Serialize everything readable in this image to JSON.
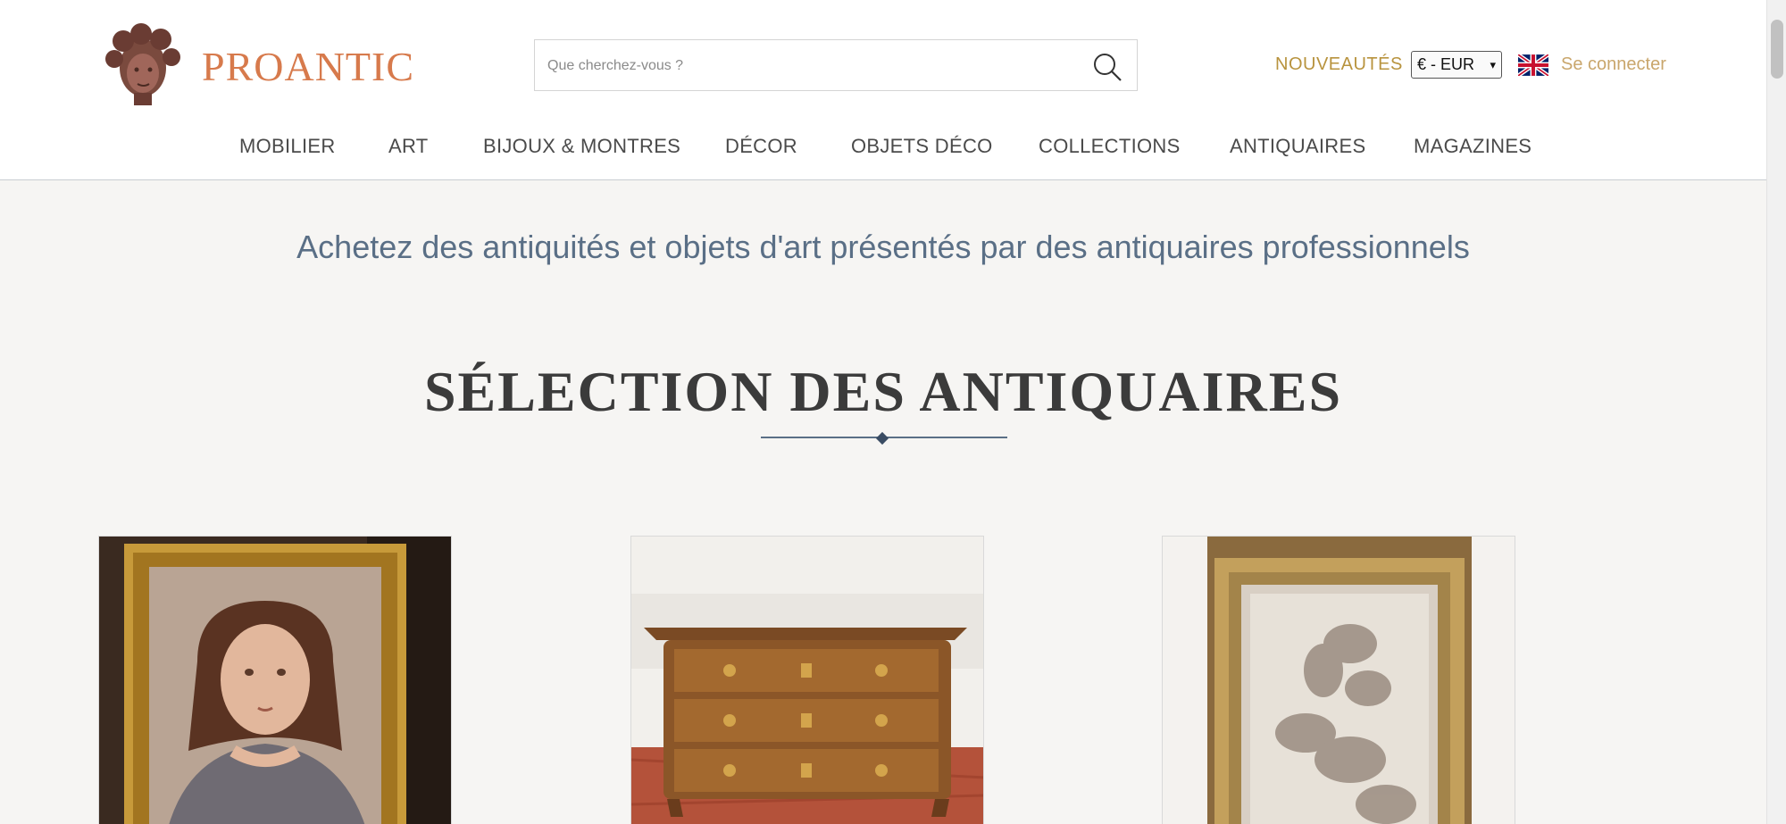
{
  "logo": {
    "text": "PROANTIC"
  },
  "search": {
    "placeholder": "Que cherchez-vous ?"
  },
  "header": {
    "nouveautes_label": "NOUVEAUTÉS",
    "currency_value": "€ - EUR",
    "login_label": "Se connecter",
    "language_icon": "uk-flag-icon"
  },
  "nav": {
    "items": [
      {
        "label": "MOBILIER"
      },
      {
        "label": "ART"
      },
      {
        "label": "BIJOUX & MONTRES"
      },
      {
        "label": "DÉCOR"
      },
      {
        "label": "OBJETS DÉCO"
      },
      {
        "label": "COLLECTIONS"
      },
      {
        "label": "ANTIQUAIRES"
      },
      {
        "label": "MAGAZINES"
      }
    ]
  },
  "main": {
    "tagline": "Achetez des antiquités et objets d'art présentés par des antiquaires professionnels",
    "section_title": "SÉLECTION DES ANTIQUAIRES"
  },
  "cards": [
    {
      "subject": "portrait of a girl in gilt frame"
    },
    {
      "subject": "marquetry commode chest of drawers"
    },
    {
      "subject": "framed drawing in gilt frame"
    }
  ],
  "colors": {
    "accent_gold": "#b8933e",
    "logo_orange": "#d77a4c",
    "tagline_blue": "#5a6f86",
    "background": "#f6f5f3"
  }
}
